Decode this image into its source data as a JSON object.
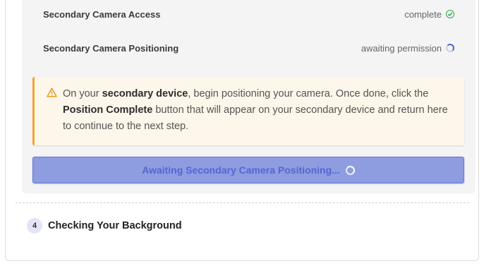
{
  "status_rows": [
    {
      "label": "Secondary Camera Access",
      "status": "complete",
      "icon": "check-circle-icon"
    },
    {
      "label": "Secondary Camera Positioning",
      "status": "awaiting permission",
      "icon": "spinner-icon"
    }
  ],
  "alert": {
    "icon": "warning-triangle-icon",
    "text_1": "On your ",
    "bold_1": "secondary device",
    "text_2": ", begin positioning your camera. Once done, click the ",
    "bold_2": "Position Complete",
    "text_3": " button that will appear on your secondary device and return here to continue to the next step."
  },
  "button": {
    "label": "Awaiting Secondary Camera Positioning..."
  },
  "next_step": {
    "number": "4",
    "title": "Checking Your Background"
  },
  "colors": {
    "success": "#27a845",
    "warning": "#f2a52f",
    "accent": "#5267d3",
    "button_bg": "#8e9ce0"
  }
}
